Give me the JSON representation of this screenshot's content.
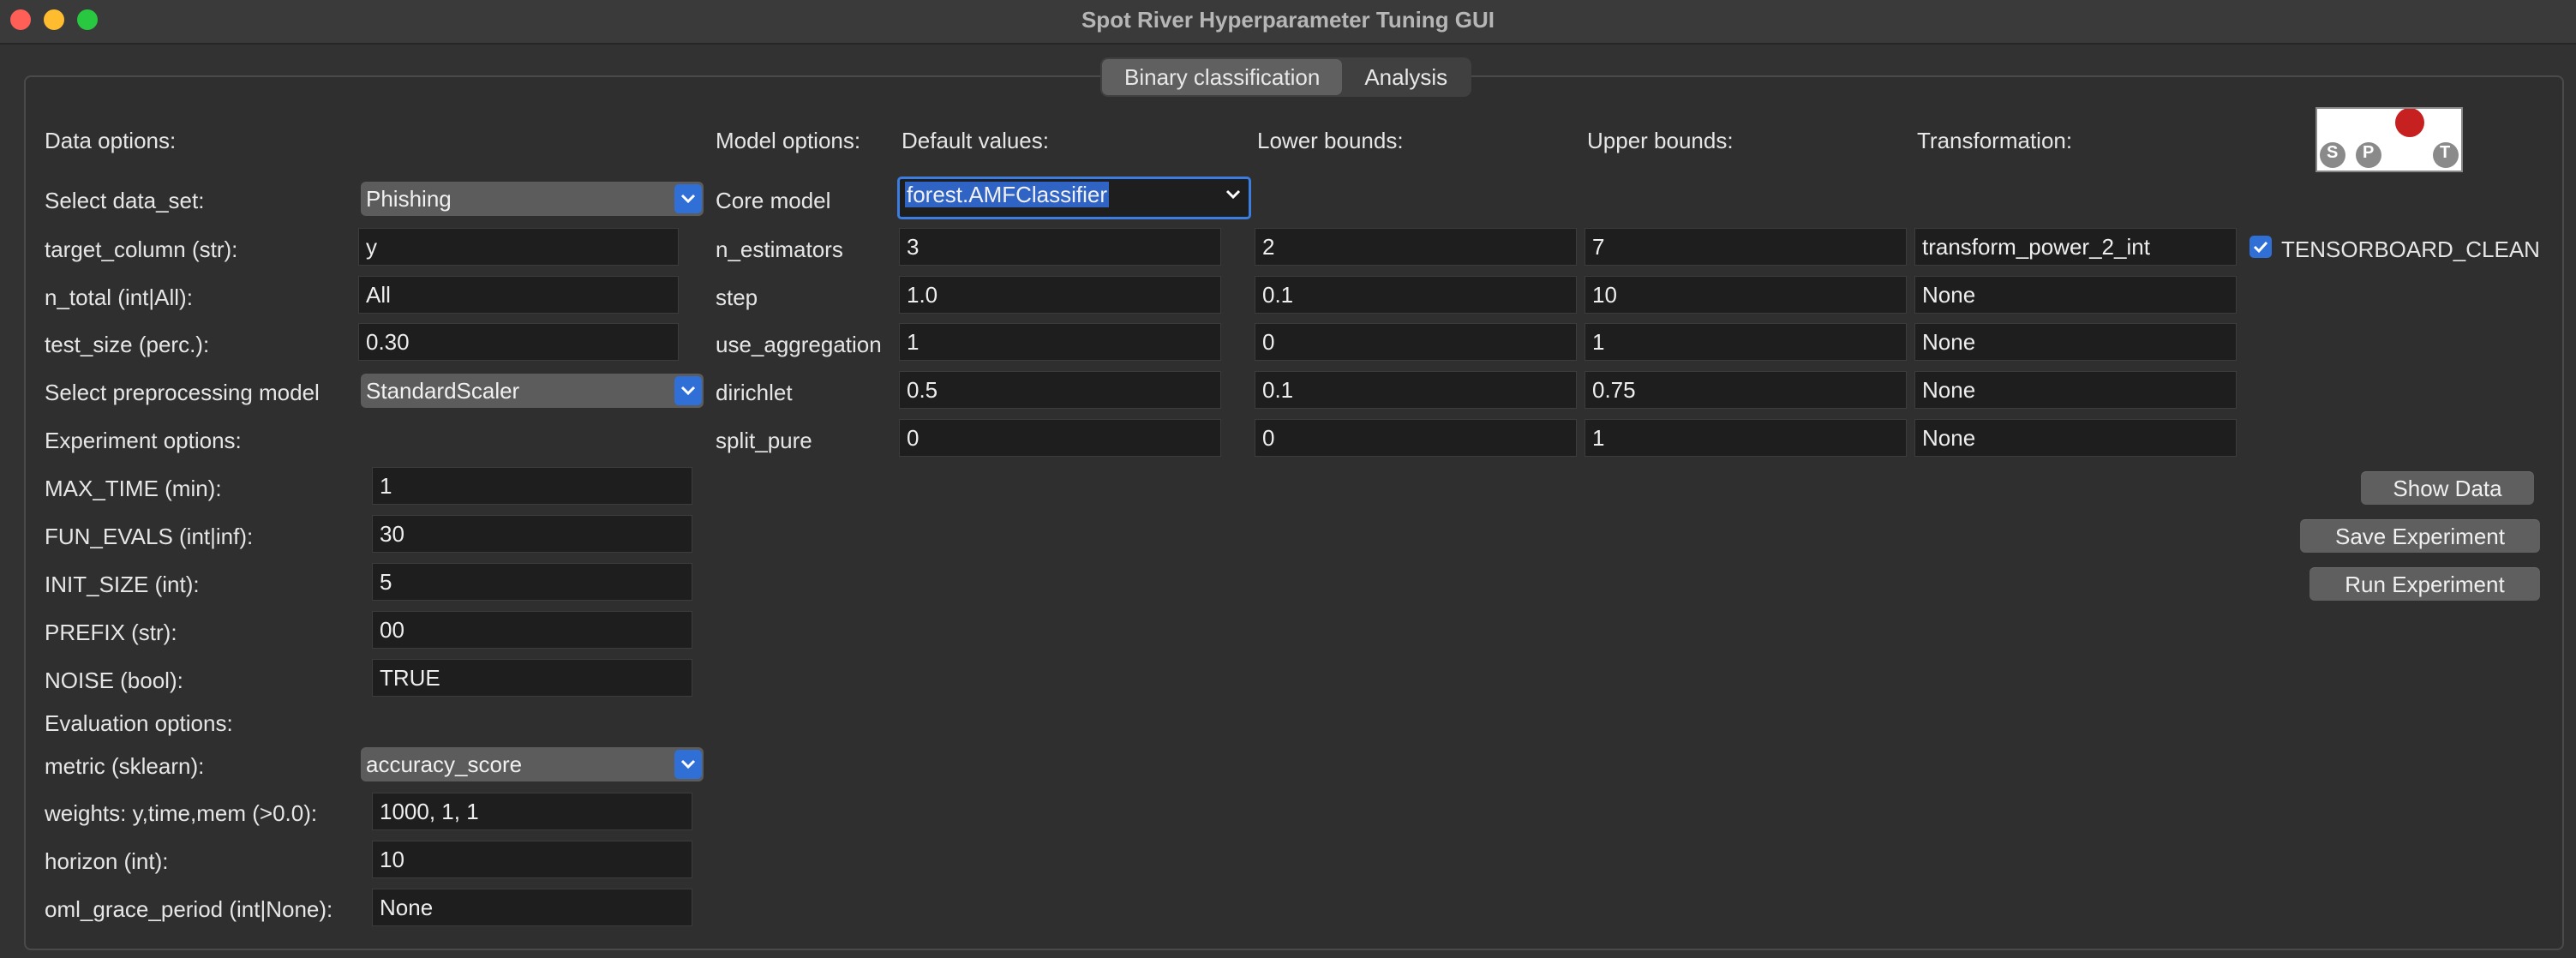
{
  "window": {
    "title": "Spot River Hyperparameter Tuning GUI"
  },
  "tabs": [
    {
      "label": "Binary classification"
    },
    {
      "label": "Analysis"
    }
  ],
  "data_options": {
    "heading": "Data options:",
    "data_set": {
      "label": "Select data_set:",
      "value": "Phishing"
    },
    "target_column": {
      "label": "target_column (str):",
      "value": "y"
    },
    "n_total": {
      "label": "n_total (int|All):",
      "value": "All"
    },
    "test_size": {
      "label": "test_size (perc.):",
      "value": "0.30"
    },
    "preprocessing": {
      "label": "Select preprocessing model",
      "value": "StandardScaler"
    }
  },
  "experiment_options": {
    "heading": "Experiment options:",
    "max_time": {
      "label": "MAX_TIME (min):",
      "value": "1"
    },
    "fun_evals": {
      "label": "FUN_EVALS (int|inf):",
      "value": "30"
    },
    "init_size": {
      "label": "INIT_SIZE (int):",
      "value": "5"
    },
    "prefix": {
      "label": "PREFIX (str):",
      "value": "00"
    },
    "noise": {
      "label": "NOISE (bool):",
      "value": "TRUE"
    }
  },
  "evaluation_options": {
    "heading": "Evaluation options:",
    "metric": {
      "label": "metric (sklearn):",
      "value": "accuracy_score"
    },
    "weights": {
      "label": "weights: y,time,mem (>0.0):",
      "value": "1000, 1, 1"
    },
    "horizon": {
      "label": "horizon (int):",
      "value": "10"
    },
    "oml_grace_period": {
      "label": "oml_grace_period (int|None):",
      "value": "None"
    }
  },
  "model_options": {
    "heading": "Model options:",
    "col_default": "Default values:",
    "col_lower": "Lower bounds:",
    "col_upper": "Upper bounds:",
    "col_transform": "Transformation:",
    "core_model": {
      "label": "Core model",
      "value": "forest.AMFClassifier"
    },
    "params": [
      {
        "name": "n_estimators",
        "default": "3",
        "lower": "2",
        "upper": "7",
        "transform": "transform_power_2_int"
      },
      {
        "name": "step",
        "default": "1.0",
        "lower": "0.1",
        "upper": "10",
        "transform": "None"
      },
      {
        "name": "use_aggregation",
        "default": "1",
        "lower": "0",
        "upper": "1",
        "transform": "None"
      },
      {
        "name": "dirichlet",
        "default": "0.5",
        "lower": "0.1",
        "upper": "0.75",
        "transform": "None"
      },
      {
        "name": "split_pure",
        "default": "0",
        "lower": "0",
        "upper": "1",
        "transform": "None"
      }
    ]
  },
  "tensorboard": {
    "label": "TENSORBOARD_CLEAN",
    "checked": true
  },
  "buttons": {
    "show_data": "Show Data",
    "save_experiment": "Save Experiment",
    "run_experiment": "Run Experiment"
  },
  "logo": {
    "letters": [
      "S",
      "P",
      "T"
    ]
  },
  "colors": {
    "accent": "#2f6fd6",
    "field_bg": "#1e1e1e",
    "window_bg": "#323232"
  }
}
